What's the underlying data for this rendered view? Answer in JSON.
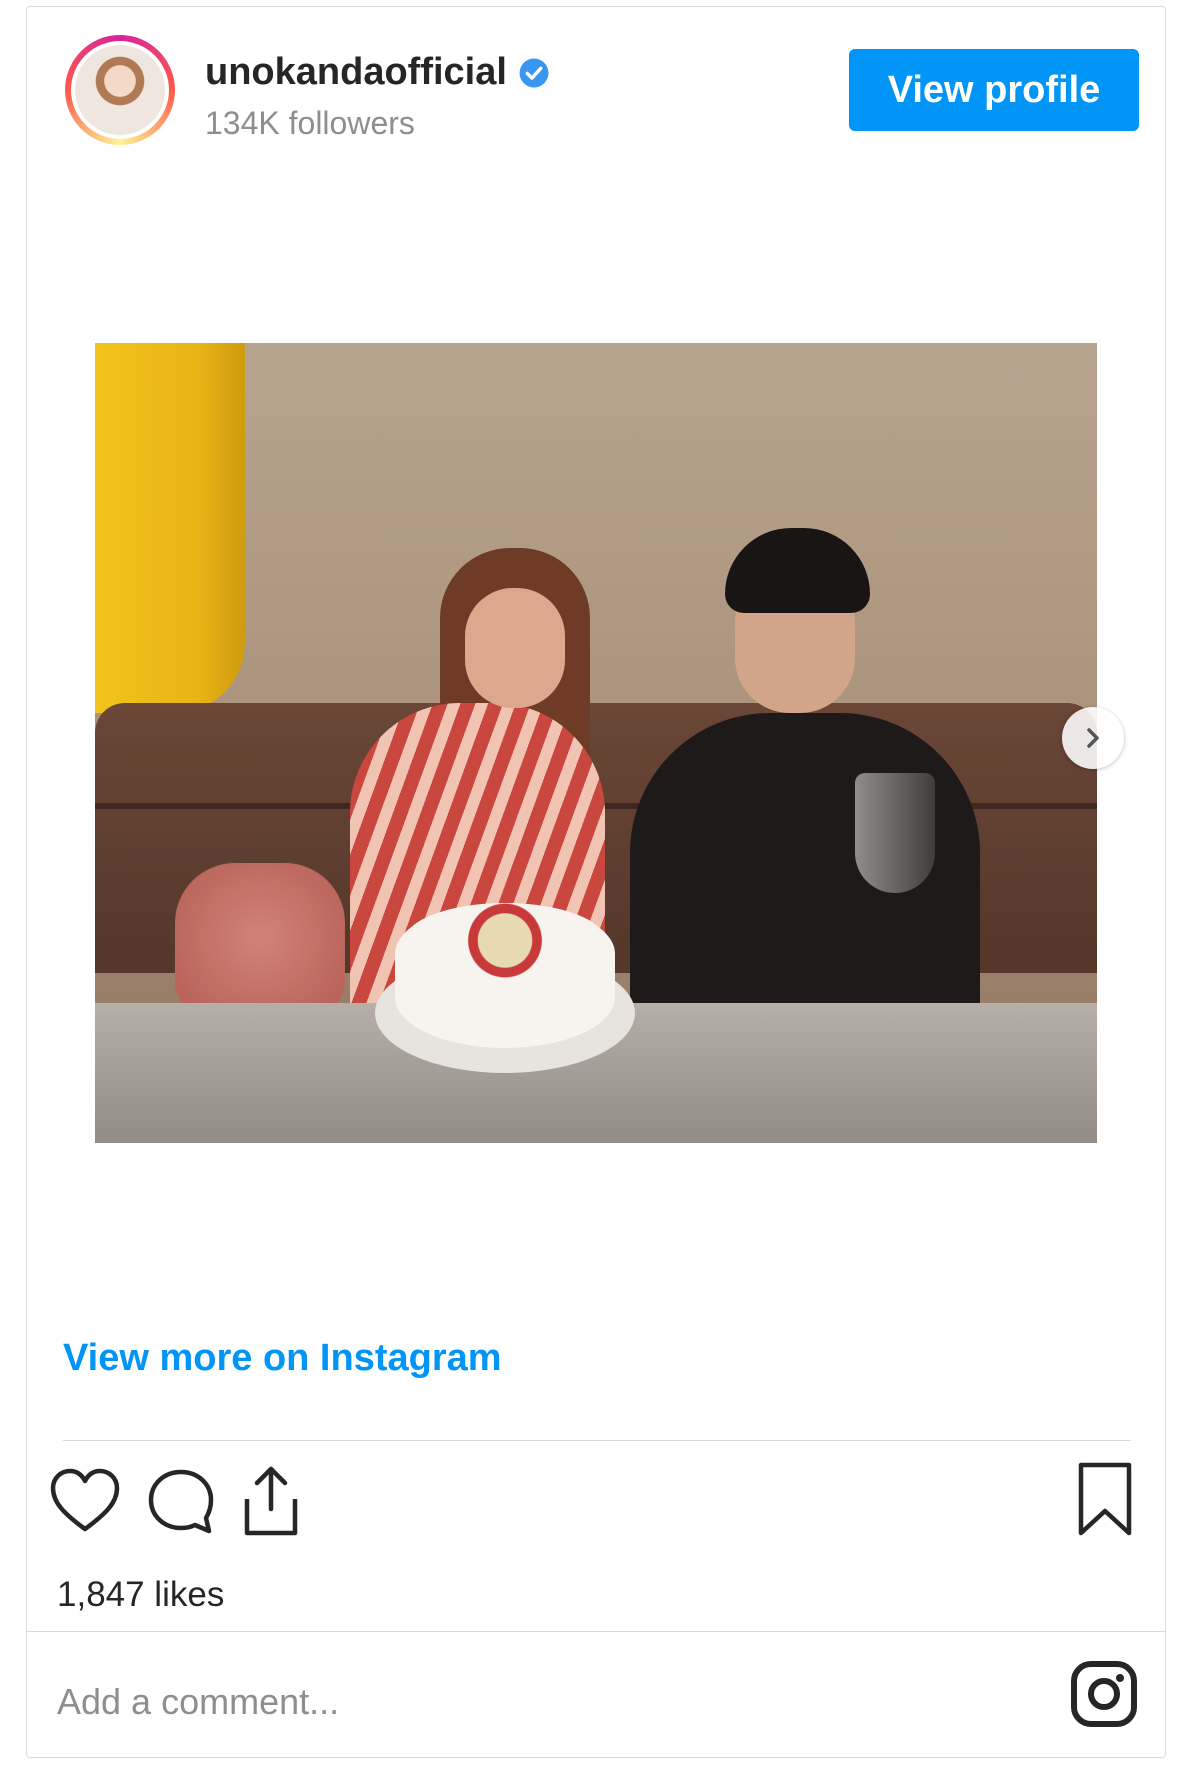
{
  "post": {
    "username": "unokandaofficial",
    "followers": "134K followers",
    "view_profile_label": "View profile",
    "view_more_label": "View more on Instagram",
    "likes": "1,847 likes",
    "comment_placeholder": "Add a comment..."
  },
  "icons": {
    "verified": "verified-badge-icon",
    "next": "chevron-right-icon",
    "like": "heart-icon",
    "comment": "comment-icon",
    "share": "share-icon",
    "save": "bookmark-icon",
    "instagram": "instagram-logo-icon"
  },
  "colors": {
    "accent": "#0095f6",
    "text": "#262626",
    "muted": "#8e8e8e",
    "border": "#dbdbdb"
  }
}
